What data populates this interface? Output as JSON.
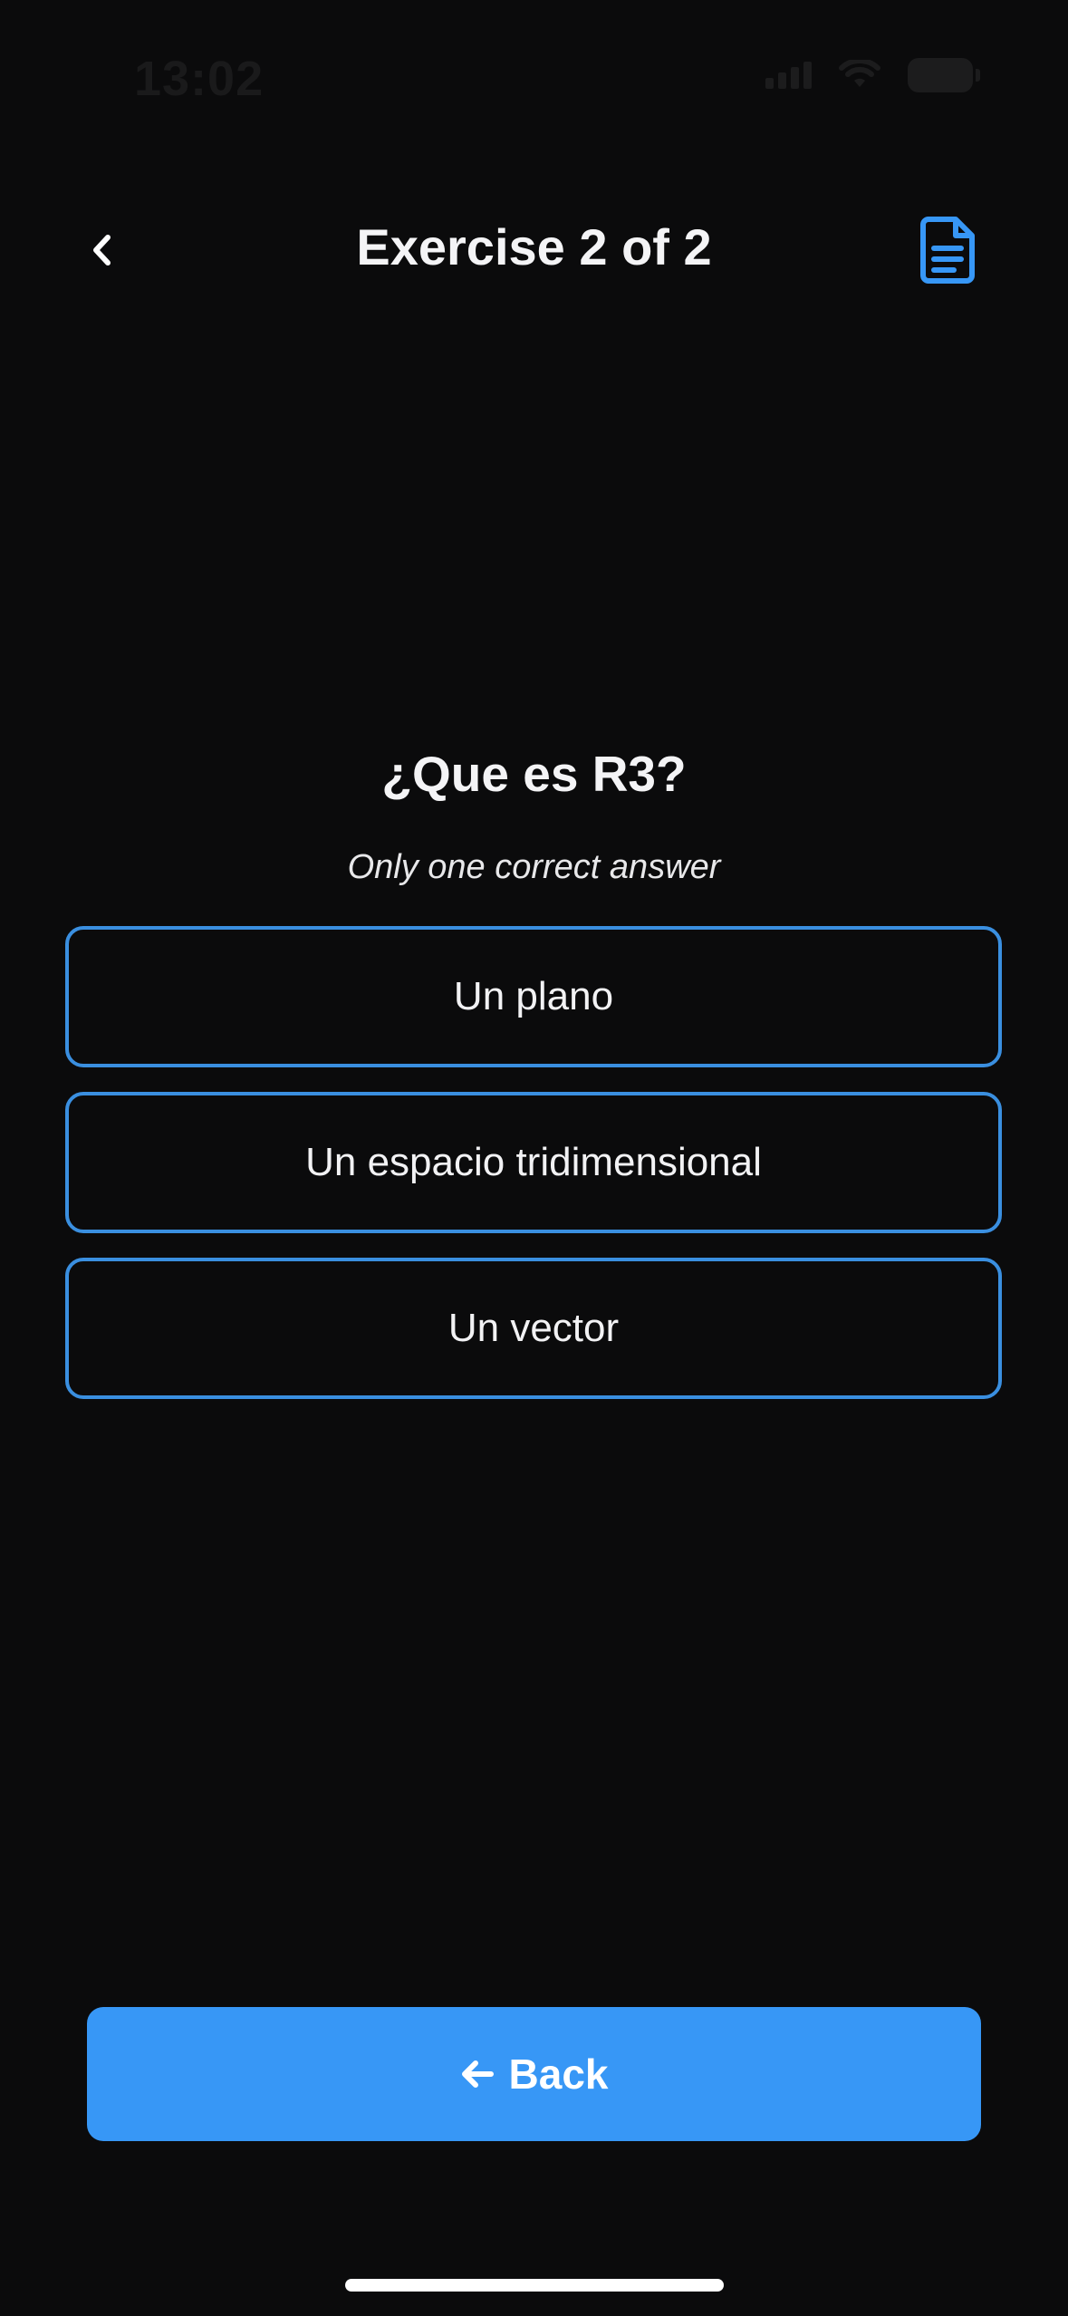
{
  "status_bar": {
    "time": "13:02"
  },
  "header": {
    "title": "Exercise 2 of 2",
    "back_icon": "chevron-left-icon",
    "doc_icon": "document-icon"
  },
  "question": {
    "text": "¿Que es R3?",
    "hint": "Only one correct answer"
  },
  "options": [
    {
      "label": "Un plano"
    },
    {
      "label": "Un espacio tridimensional"
    },
    {
      "label": "Un vector"
    }
  ],
  "footer": {
    "back_label": "Back",
    "back_icon": "arrow-left-icon"
  },
  "colors": {
    "background": "#0b0b0c",
    "accent": "#3797f6",
    "option_border": "#3a8fe0",
    "text": "#ffffff"
  }
}
